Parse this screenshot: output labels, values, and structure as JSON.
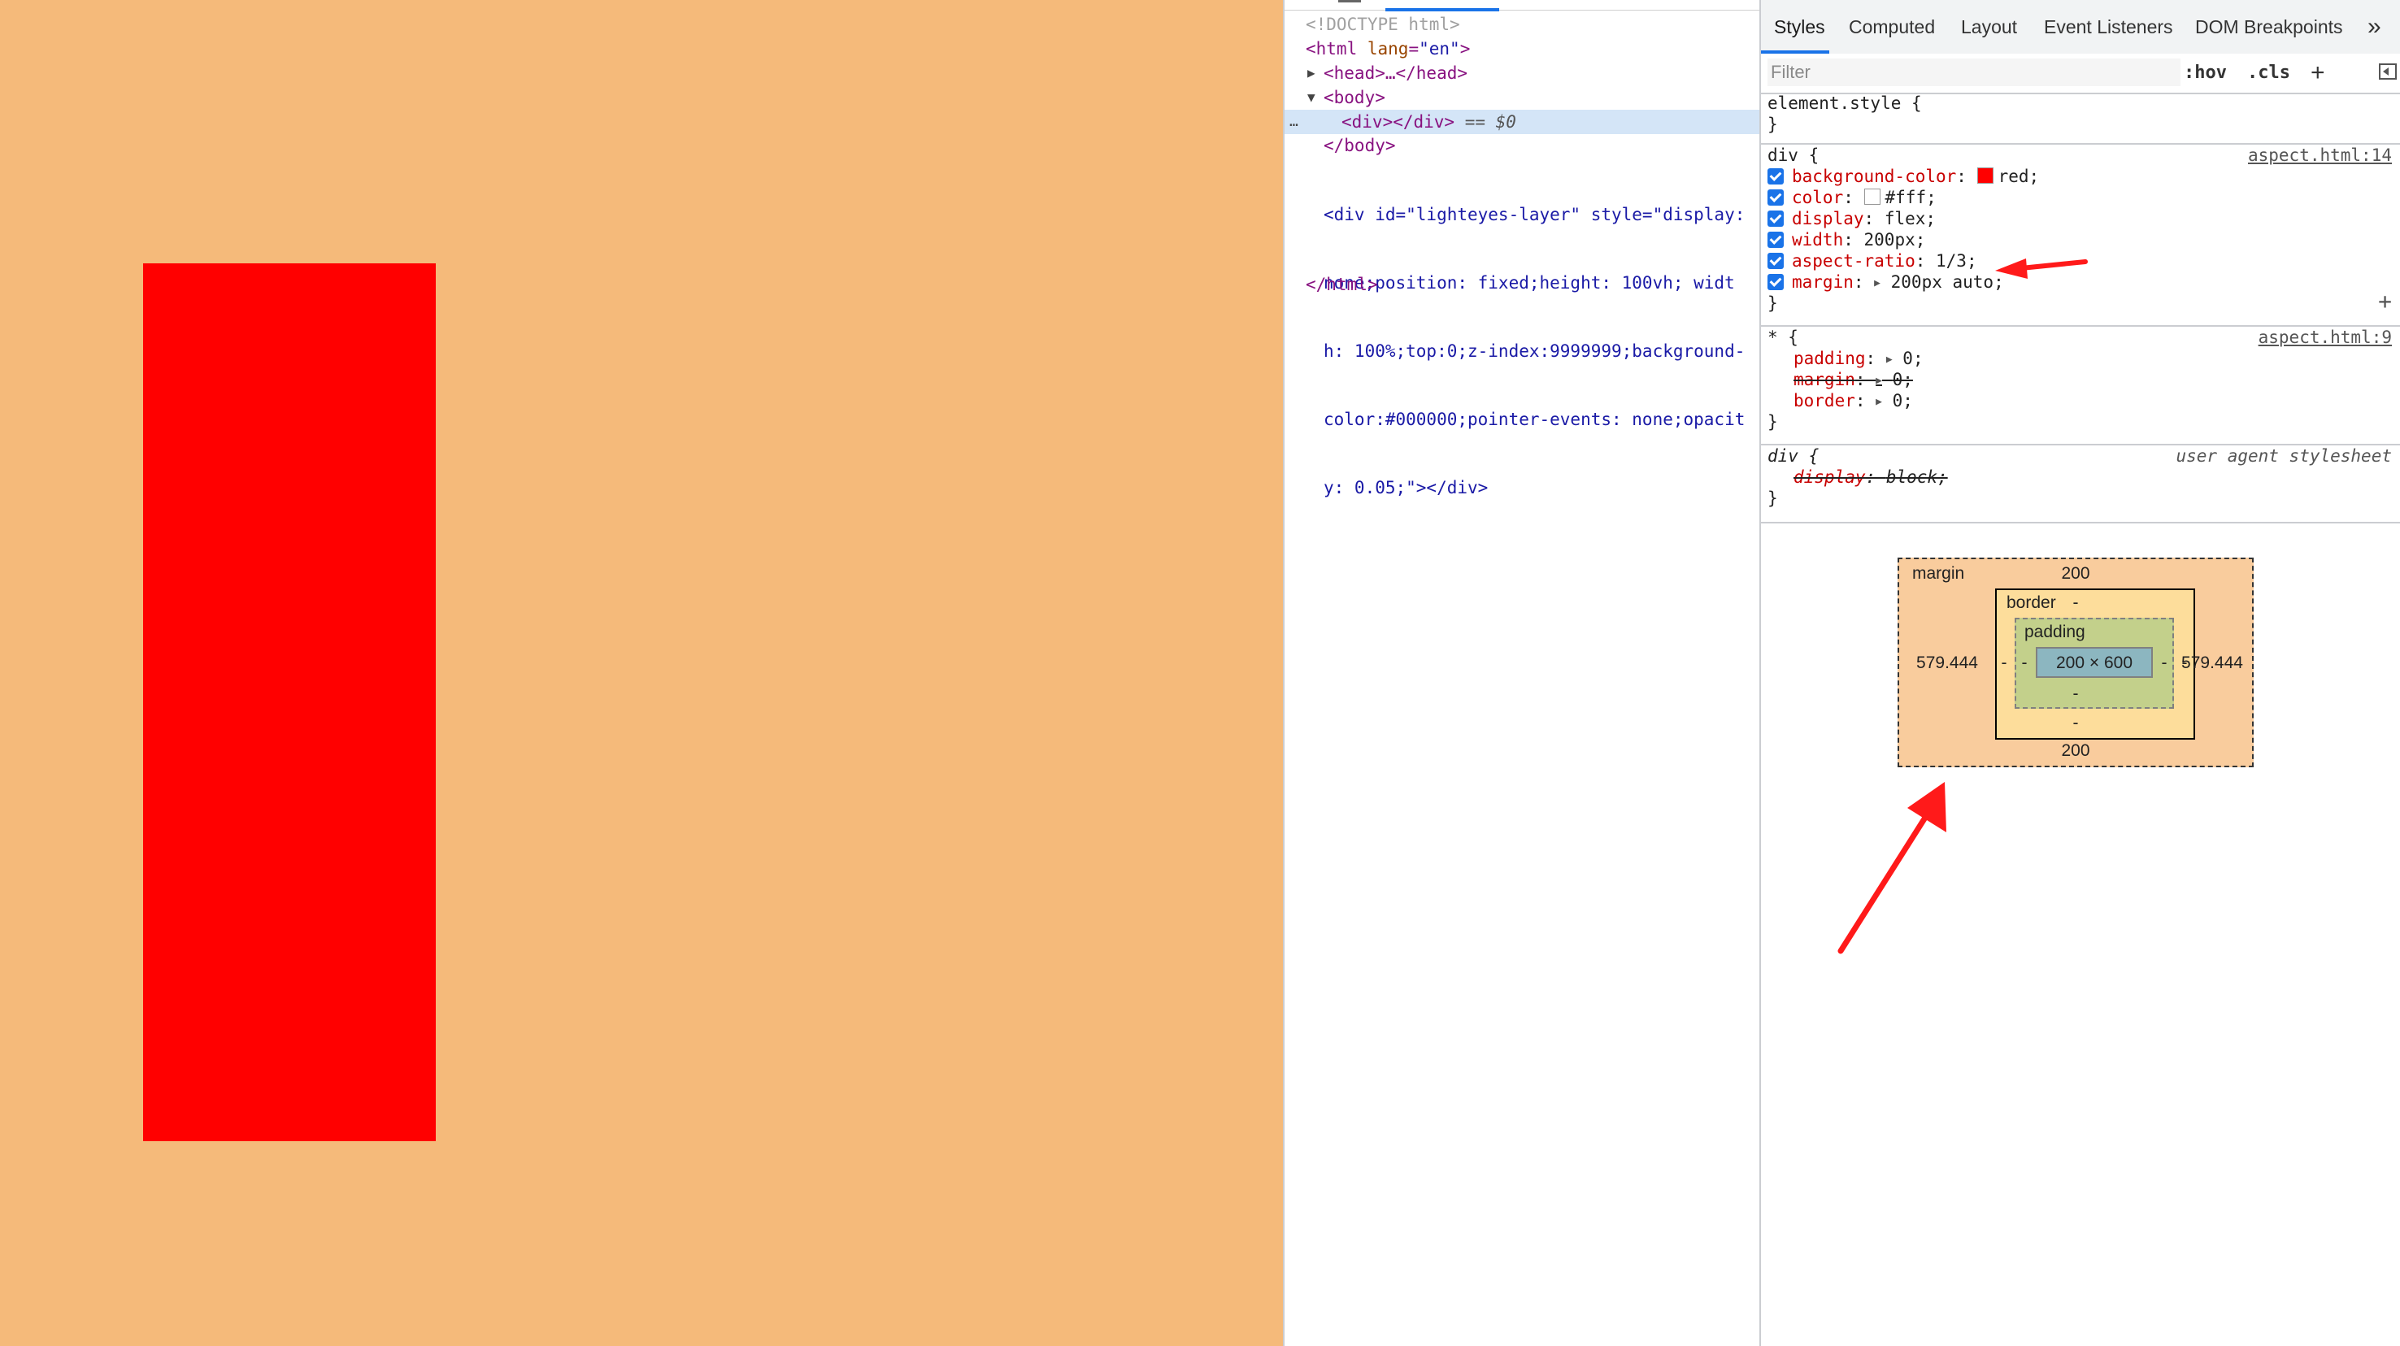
{
  "elements": {
    "doctype": "<!DOCTYPE html>",
    "html_open_tag": "<html",
    "html_lang_attr": "lang",
    "html_lang_value": "\"en\"",
    "head_collapsed": "<head>…</head>",
    "body_open": "<body>",
    "selected_div_tag": "<div></div>",
    "selected_marker": "== $0",
    "selected_dots": "…",
    "body_close": "</body>",
    "lighteyes_lines": [
      "<div id=\"lighteyes-layer\" style=\"display:",
      "none;position: fixed;height: 100vh; widt",
      "h: 100%;top:0;z-index:9999999;background-",
      "color:#000000;pointer-events: none;opacit",
      "y: 0.05;\"></div>"
    ],
    "html_close": "</html>"
  },
  "tabs": {
    "items": [
      "Styles",
      "Computed",
      "Layout",
      "Event Listeners",
      "DOM Breakpoints"
    ],
    "more": "»"
  },
  "filter": {
    "placeholder": "Filter",
    "hov": ":hov",
    "cls": ".cls",
    "plus": "+"
  },
  "rules": {
    "element_style": {
      "selector": "element.style {",
      "close": "}"
    },
    "div_rule": {
      "selector": "div {",
      "source": "aspect.html:14",
      "props": [
        {
          "name": "background-color",
          "value": "red;",
          "swatch": "#ff0000"
        },
        {
          "name": "color",
          "value": "#fff;",
          "swatch": "#ffffff"
        },
        {
          "name": "display",
          "value": "flex;"
        },
        {
          "name": "width",
          "value": "200px;"
        },
        {
          "name": "aspect-ratio",
          "value": "1/3;"
        },
        {
          "name": "margin",
          "value": "200px auto;"
        }
      ],
      "close": "}",
      "add": "+"
    },
    "star_rule": {
      "selector": "* {",
      "source": "aspect.html:9",
      "props": [
        {
          "name": "padding",
          "value": "0;"
        },
        {
          "name": "margin",
          "value": "0;"
        },
        {
          "name": "border",
          "value": "0;"
        }
      ],
      "close": "}"
    },
    "ua_rule": {
      "selector": "div {",
      "source": "user agent stylesheet",
      "prop_name": "display",
      "prop_value": "block;",
      "close": "}"
    }
  },
  "box_model": {
    "margin_label": "margin",
    "margin_top": "200",
    "margin_bottom": "200",
    "margin_left": "579.444",
    "margin_right": "579.444",
    "border_label": "border",
    "border_top": "-",
    "border_bottom": "-",
    "border_left": "-",
    "border_right": "-",
    "padding_label": "padding",
    "padding_bottom": "-",
    "padding_left": "-",
    "padding_right": "-",
    "content_size": "200 × 600"
  },
  "colors": {
    "viewport_bg": "#f5ba7a",
    "demo_box": "#ff0000",
    "annotation_arrow": "#ff1a1a",
    "accent": "#1a73e8"
  }
}
